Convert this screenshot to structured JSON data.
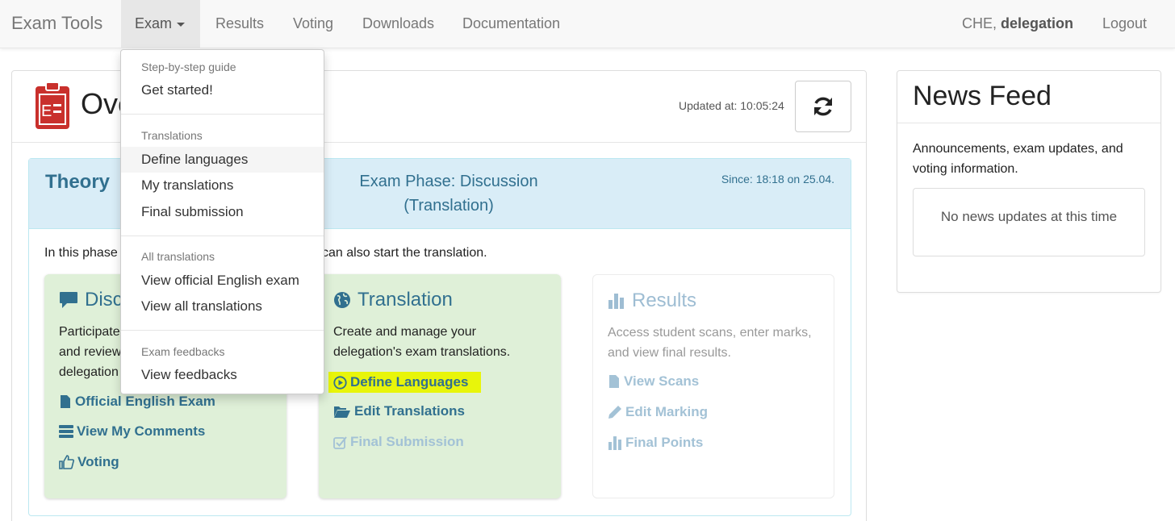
{
  "navbar": {
    "brand": "Exam Tools",
    "items": [
      {
        "label": "Exam"
      },
      {
        "label": "Results"
      },
      {
        "label": "Voting"
      },
      {
        "label": "Downloads"
      },
      {
        "label": "Documentation"
      }
    ],
    "user_country": "CHE, ",
    "user_role": "delegation",
    "logout": "Logout"
  },
  "dropdown": {
    "sections": [
      {
        "header": "Step-by-step guide",
        "items": [
          "Get started!"
        ]
      },
      {
        "header": "Translations",
        "items": [
          "Define languages",
          "My translations",
          "Final submission"
        ]
      },
      {
        "header": "All translations",
        "items": [
          "View official English exam",
          "View all translations"
        ]
      },
      {
        "header": "Exam feedbacks",
        "items": [
          "View feedbacks"
        ]
      }
    ]
  },
  "overview": {
    "title": "Ove",
    "updated_at": "Updated at: 10:05:24",
    "section_title": "Theory",
    "phase_line1": "Exam Phase: Discussion",
    "phase_line2": "(Translation)",
    "since": "Since: 18:18 on 25.04.",
    "intro": "In this phase",
    "intro_tail": "can also start the translation."
  },
  "cards": {
    "discussion": {
      "title": "Discu",
      "desc": "Participate\nand review\ndelegation",
      "links": [
        "Official English Exam",
        "View My Comments",
        "Voting"
      ]
    },
    "translation": {
      "title": "Translation",
      "desc": "Create and manage your delegation's exam translations.",
      "links": [
        "Define Languages",
        "Edit Translations",
        "Final Submission"
      ]
    },
    "results": {
      "title": "Results",
      "desc": "Access student scans, enter marks, and view final results.",
      "links": [
        "View Scans",
        "Edit Marking",
        "Final Points"
      ]
    }
  },
  "news": {
    "title": "News Feed",
    "desc": "Announcements, exam updates, and voting information.",
    "empty": "No news updates at this time"
  },
  "colors": {
    "accent": "#31708f",
    "highlight": "#e8f50a",
    "info_bg": "#d9edf7",
    "success_bg": "#dff0d8"
  }
}
